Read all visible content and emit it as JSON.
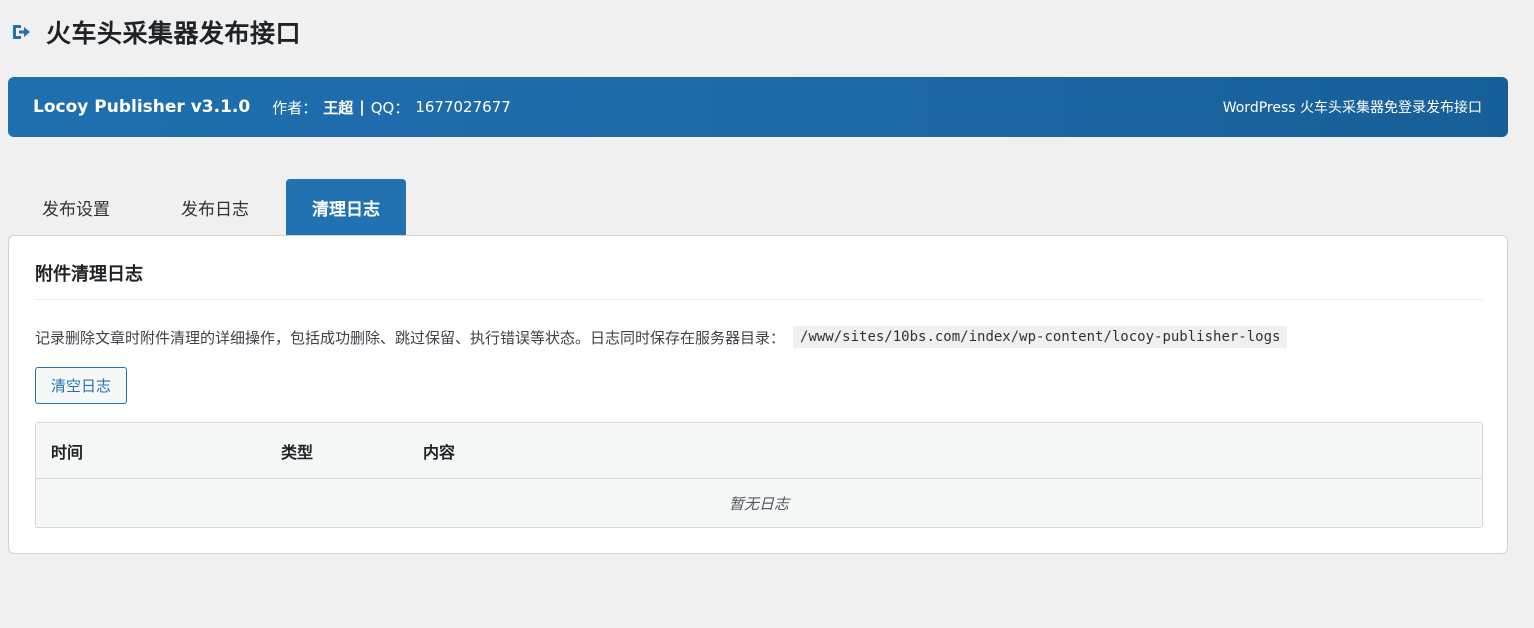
{
  "page": {
    "title": "火车头采集器发布接口",
    "title_icon": "exit-arrow-icon"
  },
  "banner": {
    "product": "Locoy Publisher v3.1.0",
    "author_label": "作者：",
    "author_name": "王超",
    "separator": "|",
    "qq_label": "QQ：",
    "qq_value": "1677027677",
    "tagline": "WordPress 火车头采集器免登录发布接口"
  },
  "tabs": [
    {
      "label": "发布设置",
      "active": false
    },
    {
      "label": "发布日志",
      "active": false
    },
    {
      "label": "清理日志",
      "active": true
    }
  ],
  "panel": {
    "heading": "附件清理日志",
    "description": "记录删除文章时附件清理的详细操作，包括成功删除、跳过保留、执行错误等状态。日志同时保存在服务器目录：",
    "log_path": "/www/sites/10bs.com/index/wp-content/locoy-publisher-logs",
    "clear_button": "清空日志"
  },
  "table": {
    "columns": [
      "时间",
      "类型",
      "内容"
    ],
    "empty_message": "暂无日志"
  },
  "colors": {
    "accent": "#2271b1",
    "banner_start": "#1f6fae",
    "banner_end": "#175f98",
    "background": "#f0f0f1"
  }
}
